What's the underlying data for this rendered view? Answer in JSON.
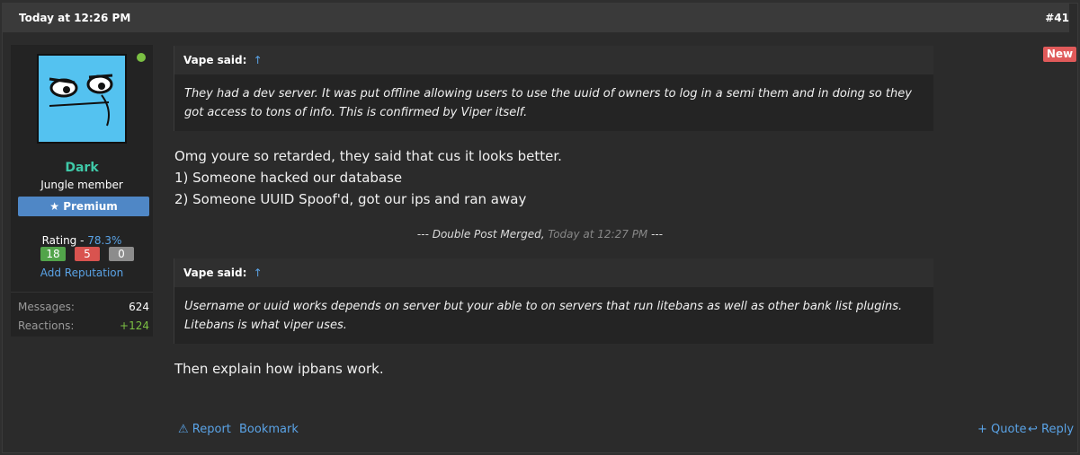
{
  "post": {
    "date": "Today at 12:26 PM",
    "number": "#41",
    "new_badge": "New"
  },
  "user": {
    "name": "Dark",
    "title": "Jungle member",
    "premium": "Premium",
    "rating_label": "Rating - ",
    "rating_pct": "78.3%",
    "rating_pos": "18",
    "rating_neg": "5",
    "rating_neu": "0",
    "add_reputation": "Add Reputation",
    "messages_label": "Messages:",
    "messages_value": "624",
    "reactions_label": "Reactions:",
    "reactions_value": "+124"
  },
  "quote1": {
    "author": "Vape said:",
    "arrow": "↑",
    "text": "They had a dev server. It was put offline allowing users to use the uuid of owners to log in a semi them and in doing so they got access to tons of info. This is confirmed by Viper itself."
  },
  "message1": {
    "line1": "Omg youre so retarded, they said that cus it looks better.",
    "line2": "1) Someone hacked our database",
    "line3": "2) Someone UUID Spoof'd, got our ips and ran away"
  },
  "merged": {
    "prefix": "--- ",
    "label": "Double Post Merged,",
    "time": "Today at 12:27 PM",
    "suffix": " ---"
  },
  "quote2": {
    "author": "Vape said:",
    "arrow": "↑",
    "text": "Username or uuid works depends on server but your able to on servers that run litebans as well as other bank list plugins. Litebans is what viper uses."
  },
  "message2": {
    "line1": "Then explain how ipbans work."
  },
  "actions": {
    "report": "Report",
    "bookmark": "Bookmark",
    "quote": "+ Quote",
    "reply": "Reply"
  },
  "icons": {
    "trophy": "trophy-icon",
    "warning": "warning-icon",
    "reply": "reply-icon"
  }
}
